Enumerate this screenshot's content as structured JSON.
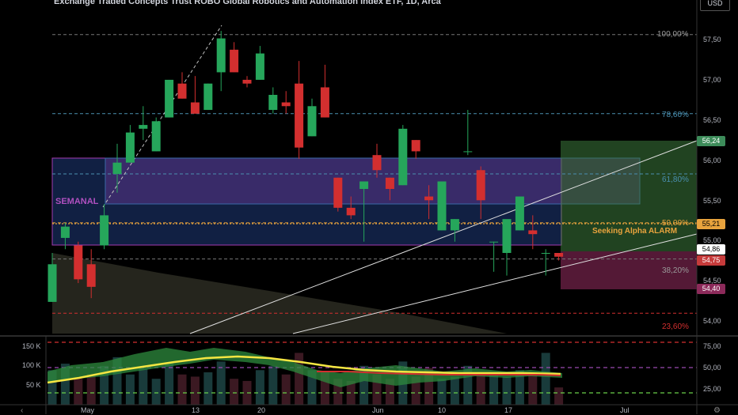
{
  "header": {
    "title": "Exchange Traded Concepts Trust ROBO Global Robotics and Automation Index ETF, 1D, Arca",
    "currency": "USD"
  },
  "price_axis": {
    "ticks": [
      "57,50",
      "57,00",
      "56,50",
      "56,00",
      "55,50",
      "55,00",
      "54,50",
      "54,00"
    ],
    "tags": [
      {
        "label": "56,24",
        "bg": "#3d8c5a",
        "fg": "#ffffff"
      },
      {
        "label": "55,21",
        "bg": "#e8a33d",
        "fg": "#000000"
      },
      {
        "label": "54,86",
        "bg": "#ffffff",
        "fg": "#000000"
      },
      {
        "label": "54,75",
        "bg": "#c63b3b",
        "fg": "#ffffff"
      },
      {
        "label": "54,40",
        "bg": "#8c2a5a",
        "fg": "#ffffff"
      }
    ]
  },
  "fib_levels": [
    "100,00%",
    "78,60%",
    "61,80%",
    "50,00%",
    "38,20%",
    "23,60%"
  ],
  "annotations": {
    "semanal": "SEMANAL",
    "alarm": "Seeking Alpha ALARM"
  },
  "oscillator_axis": {
    "left_ticks": [
      "150 K",
      "100 K",
      "50 K"
    ],
    "right_ticks": [
      "75,00",
      "50,00",
      "25,00"
    ]
  },
  "time_axis": {
    "labels": [
      "May",
      "13",
      "20",
      "Jun",
      "10",
      "17",
      "Jul"
    ]
  },
  "colors": {
    "up": "#26a65b",
    "down": "#d32f2f",
    "semanal_box": "#1f3a7a",
    "purple_zone": "#6a3a9a",
    "fib_line": "#4a8fb0",
    "alarm": "#e8a33d"
  },
  "chart_data": {
    "type": "candlestick",
    "candles": [
      {
        "o": 54.15,
        "h": 54.8,
        "l": 54.15,
        "c": 54.65
      },
      {
        "o": 55.0,
        "h": 55.2,
        "l": 54.85,
        "c": 55.15
      },
      {
        "o": 54.9,
        "h": 54.95,
        "l": 54.4,
        "c": 54.45
      },
      {
        "o": 54.65,
        "h": 54.85,
        "l": 54.2,
        "c": 54.35
      },
      {
        "o": 54.9,
        "h": 55.45,
        "l": 54.85,
        "c": 55.3
      },
      {
        "o": 55.85,
        "h": 56.25,
        "l": 55.6,
        "c": 56.0
      },
      {
        "o": 56.0,
        "h": 56.5,
        "l": 56.0,
        "c": 56.4
      },
      {
        "o": 56.45,
        "h": 56.75,
        "l": 56.3,
        "c": 56.5
      },
      {
        "o": 56.15,
        "h": 56.6,
        "l": 56.15,
        "c": 56.55
      },
      {
        "o": 56.6,
        "h": 57.1,
        "l": 56.6,
        "c": 57.1
      },
      {
        "o": 57.05,
        "h": 57.2,
        "l": 56.85,
        "c": 56.85
      },
      {
        "o": 56.8,
        "h": 57.15,
        "l": 56.65,
        "c": 56.65
      },
      {
        "o": 56.7,
        "h": 57.05,
        "l": 56.7,
        "c": 57.05
      },
      {
        "o": 57.2,
        "h": 57.75,
        "l": 56.95,
        "c": 57.65
      },
      {
        "o": 57.5,
        "h": 57.6,
        "l": 57.2,
        "c": 57.2
      },
      {
        "o": 57.1,
        "h": 57.15,
        "l": 57.0,
        "c": 57.05
      },
      {
        "o": 57.1,
        "h": 57.55,
        "l": 57.1,
        "c": 57.45
      },
      {
        "o": 56.7,
        "h": 57.0,
        "l": 56.65,
        "c": 56.9
      },
      {
        "o": 56.8,
        "h": 56.95,
        "l": 56.65,
        "c": 56.75
      },
      {
        "o": 57.05,
        "h": 57.35,
        "l": 56.05,
        "c": 56.2
      },
      {
        "o": 56.35,
        "h": 56.85,
        "l": 56.35,
        "c": 56.75
      },
      {
        "o": 57.0,
        "h": 57.3,
        "l": 56.6,
        "c": 56.6
      },
      {
        "o": 55.8,
        "h": 55.8,
        "l": 55.35,
        "c": 55.4
      },
      {
        "o": 55.4,
        "h": 55.55,
        "l": 55.25,
        "c": 55.3
      },
      {
        "o": 55.65,
        "h": 55.75,
        "l": 54.95,
        "c": 55.75
      },
      {
        "o": 56.1,
        "h": 56.25,
        "l": 55.8,
        "c": 55.9
      },
      {
        "o": 55.8,
        "h": 55.8,
        "l": 55.5,
        "c": 55.65
      },
      {
        "o": 55.7,
        "h": 56.5,
        "l": 55.7,
        "c": 56.45
      },
      {
        "o": 56.3,
        "h": 56.3,
        "l": 56.05,
        "c": 56.15
      },
      {
        "o": 55.55,
        "h": 55.7,
        "l": 55.25,
        "c": 55.5
      },
      {
        "o": 55.1,
        "h": 55.75,
        "l": 55.1,
        "c": 55.75
      },
      {
        "o": 55.1,
        "h": 55.25,
        "l": 54.95,
        "c": 55.25
      },
      {
        "o": 56.15,
        "h": 56.7,
        "l": 56.1,
        "c": 56.15
      },
      {
        "o": 55.9,
        "h": 55.95,
        "l": 55.25,
        "c": 55.5
      },
      {
        "o": 54.95,
        "h": 54.95,
        "l": 54.55,
        "c": 54.95
      },
      {
        "o": 54.8,
        "h": 55.2,
        "l": 54.5,
        "c": 55.25
      },
      {
        "o": 55.1,
        "h": 55.55,
        "l": 55.1,
        "c": 55.55
      },
      {
        "o": 55.1,
        "h": 55.3,
        "l": 54.85,
        "c": 55.05
      },
      {
        "o": 54.8,
        "h": 54.85,
        "l": 54.5,
        "c": 54.8
      },
      {
        "o": 54.8,
        "h": 54.8,
        "l": 54.7,
        "c": 54.75
      }
    ],
    "volume": [
      80,
      95,
      60,
      70,
      90,
      110,
      70,
      85,
      60,
      95,
      70,
      65,
      75,
      100,
      60,
      55,
      80,
      90,
      70,
      120,
      80,
      75,
      60,
      55,
      90,
      70,
      60,
      100,
      65,
      85,
      60,
      65,
      90,
      75,
      70,
      65,
      80,
      75,
      120,
      40
    ],
    "fib_levels": [
      {
        "label": "100,00%",
        "price": 57.7
      },
      {
        "label": "78,60%",
        "price": 56.65
      },
      {
        "label": "61,80%",
        "price": 55.85
      },
      {
        "label": "50,00%",
        "price": 55.2
      },
      {
        "label": "38,20%",
        "price": 54.72
      },
      {
        "label": "23,60%",
        "price": 54.0
      }
    ],
    "ylim": [
      53.75,
      57.95
    ]
  }
}
